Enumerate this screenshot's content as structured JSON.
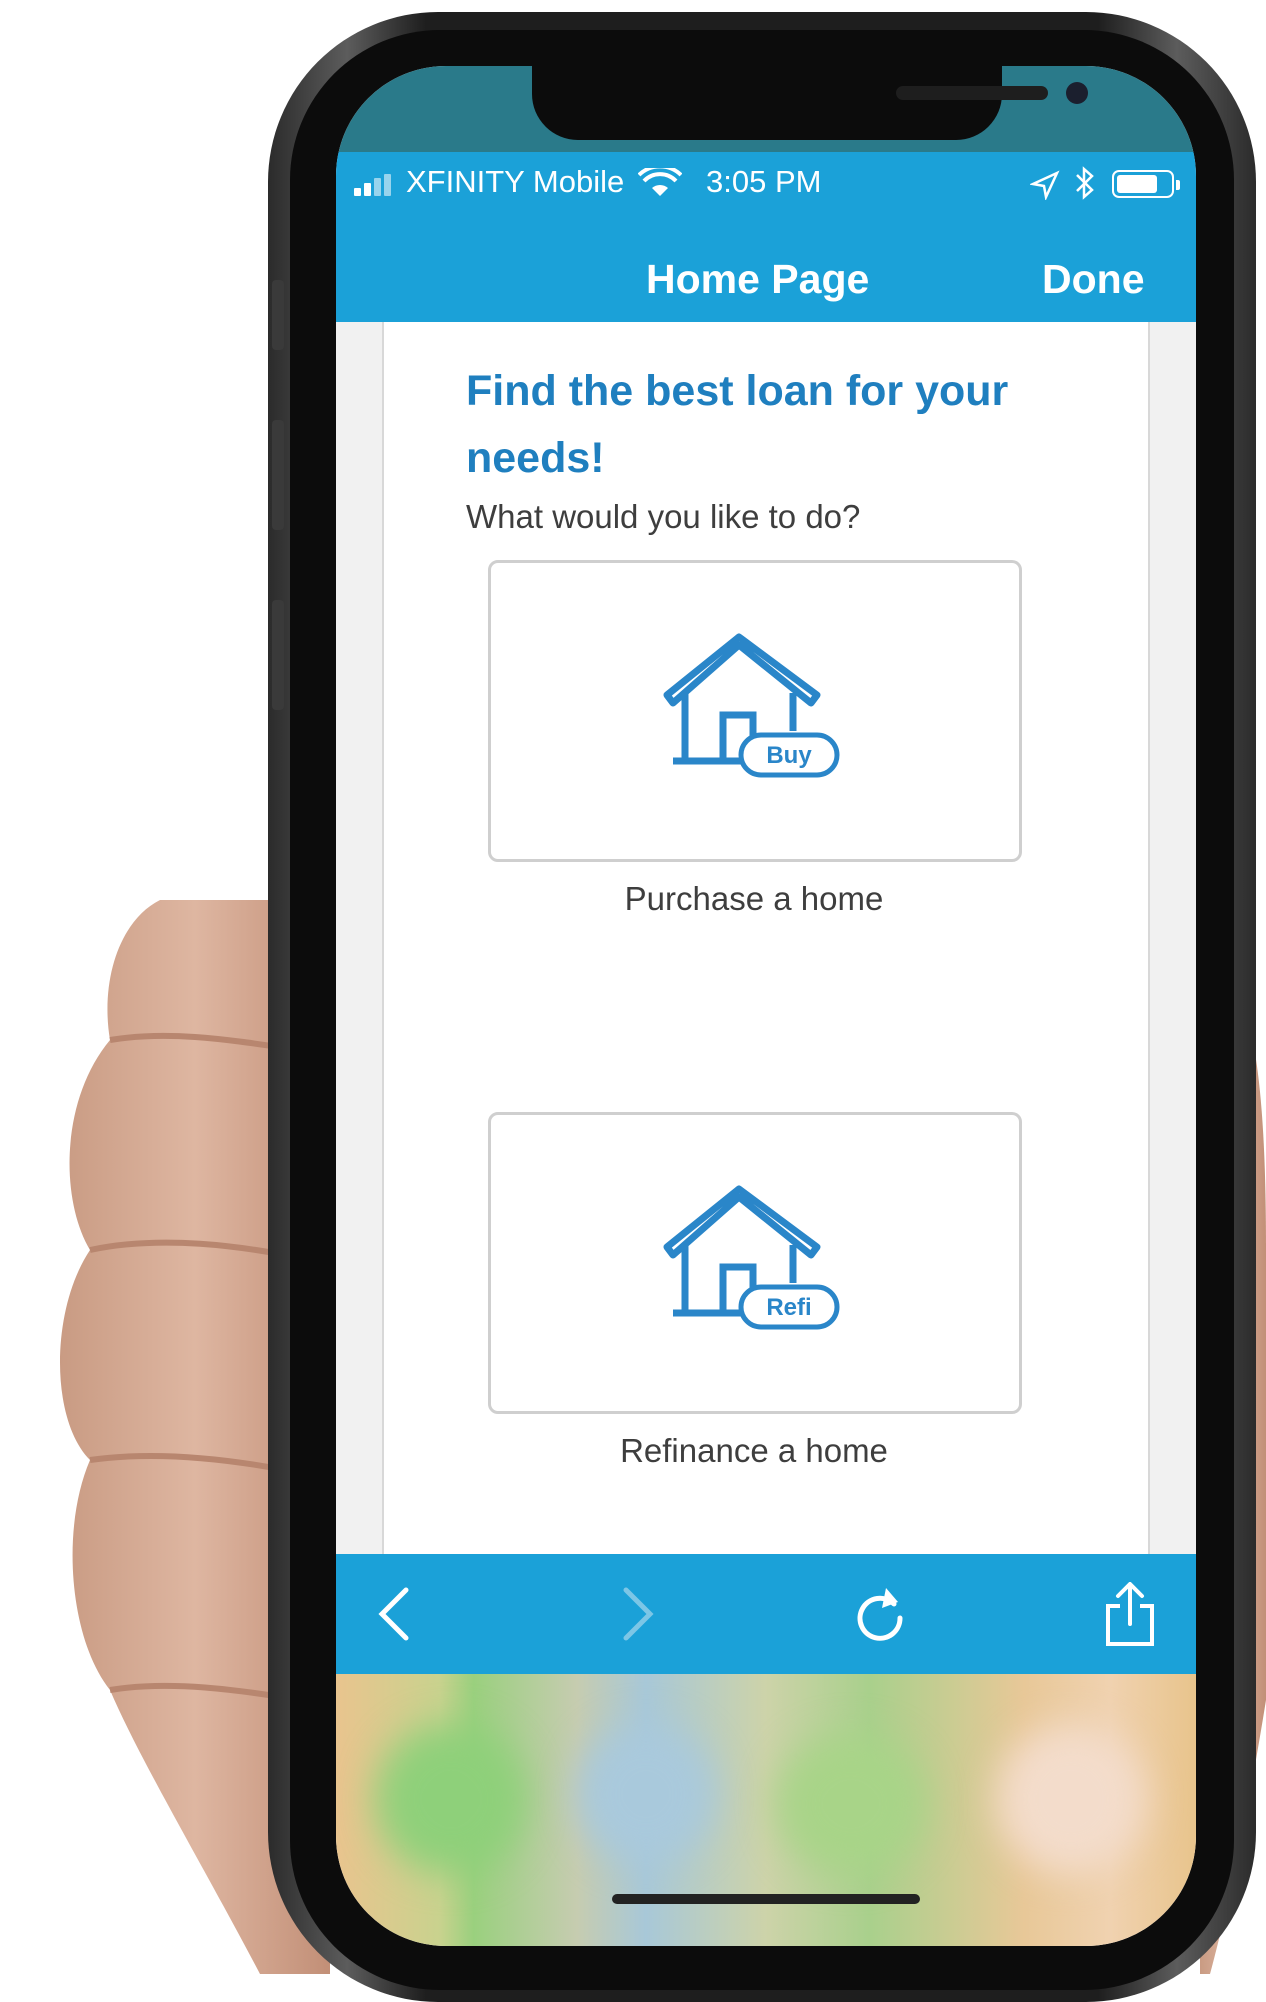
{
  "status_bar": {
    "carrier": "XFINITY Mobile",
    "time": "3:05 PM"
  },
  "nav": {
    "title": "Home Page",
    "done_label": "Done"
  },
  "content": {
    "headline": "Find the best loan for your needs!",
    "question": "What would you like to do?",
    "options": [
      {
        "badge": "Buy",
        "label": "Purchase a home",
        "icon": "house-buy-icon"
      },
      {
        "badge": "Refi",
        "label": "Refinance a home",
        "icon": "house-refi-icon"
      }
    ]
  },
  "toolbar": {
    "icons": [
      "back-icon",
      "forward-icon",
      "reload-icon",
      "share-icon"
    ]
  },
  "colors": {
    "accent": "#1ba1d8",
    "headline": "#1f7fbf",
    "icon_blue": "#2a86c9"
  }
}
